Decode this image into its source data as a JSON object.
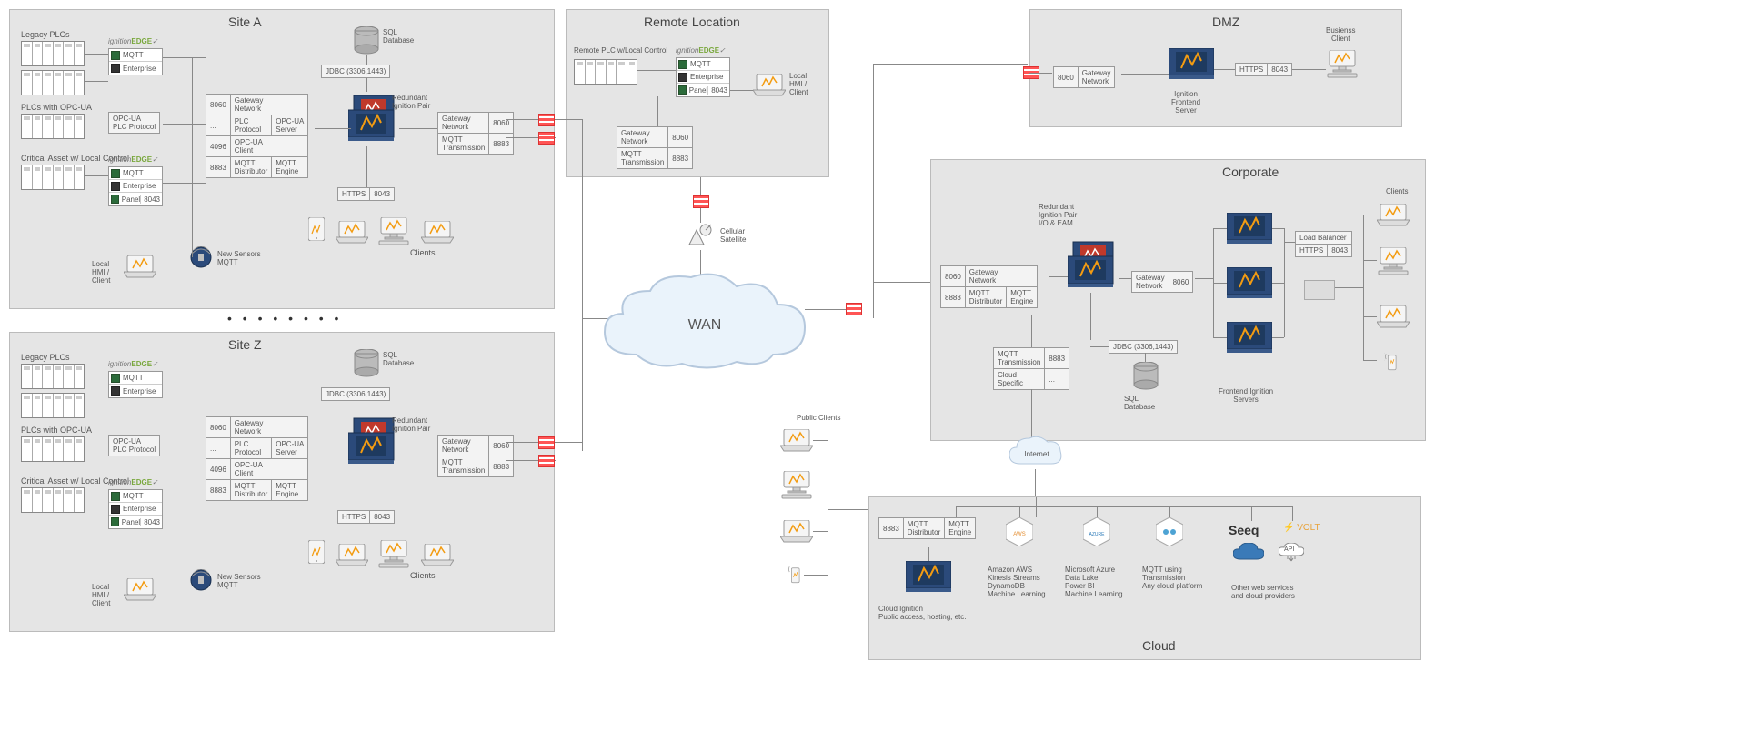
{
  "regions": {
    "siteA": {
      "title": "Site A"
    },
    "siteZ": {
      "title": "Site Z"
    },
    "remote": {
      "title": "Remote Location",
      "plc_label": "Remote PLC w/Local Control"
    },
    "dmz": {
      "title": "DMZ"
    },
    "corporate": {
      "title": "Corporate"
    },
    "cloud": {
      "title": "Cloud"
    }
  },
  "site": {
    "legacy_label": "Legacy PLCs",
    "opcua_label": "PLCs with OPC-UA",
    "critical_label": "Critical Asset w/ Local Control",
    "opcua_plc_box": "OPC-UA\nPLC Protocol",
    "local_hmi": "Local\nHMI /\nClient",
    "new_sensors": "New Sensors\nMQTT",
    "sql_db": "SQL\nDatabase",
    "jdbc": "JDBC (3306,1443)",
    "redundant_pair": "Redundant\nIgnition Pair",
    "clients": "Clients",
    "edge_rows": {
      "mqtt": "MQTT",
      "enterprise": "Enterprise",
      "panel": "Panel"
    },
    "port_https": "8043",
    "left_table": [
      [
        "8060",
        "Gateway\nNetwork",
        ""
      ],
      [
        "...",
        "PLC\nProtocol",
        "OPC-UA\nServer"
      ],
      [
        "4096",
        "OPC-UA\nClient",
        ""
      ],
      [
        "8883",
        "MQTT\nDistributor",
        "MQTT\nEngine"
      ]
    ],
    "https_row": [
      "HTTPS",
      "8043"
    ],
    "right_table": [
      [
        "Gateway\nNetwork",
        "8060"
      ],
      [
        "MQTT\nTransmission",
        "8883"
      ]
    ],
    "edge_logo_pre": "ignition",
    "edge_logo_suf": "EDGE"
  },
  "remote": {
    "local_hmi": "Local\nHMI /\nClient",
    "table": [
      [
        "Gateway\nNetwork",
        "8060"
      ],
      [
        "MQTT\nTransmission",
        "8883"
      ]
    ],
    "cellular": "Cellular\nSatellite"
  },
  "wan": {
    "label": "WAN"
  },
  "dmz": {
    "gw_row": [
      "8060",
      "Gateway\nNetwork"
    ],
    "https_row": [
      "HTTPS",
      "8043"
    ],
    "frontend": "Ignition\nFrontend\nServer",
    "business": "Busienss\nClient"
  },
  "corporate": {
    "gw_left": [
      [
        "8060",
        "Gateway\nNetwork",
        ""
      ],
      [
        "8883",
        "MQTT\nDistributor",
        "MQTT\nEngine"
      ]
    ],
    "redundant": "Redundant\nIgnition Pair\nI/O & EAM",
    "gw_right": [
      "Gateway\nNetwork",
      "8060"
    ],
    "jdbc": "JDBC (3306,1443)",
    "sql_db": "SQL\nDatabase",
    "mqtt_trans": [
      [
        "MQTT\nTransmission",
        "8883"
      ],
      [
        "Cloud\nSpecific",
        "..."
      ]
    ],
    "load_balancer": "Load Balancer",
    "lb_row": [
      "HTTPS",
      "8043"
    ],
    "frontend_servers": "Frontend Ignition\nServers",
    "clients": "Clients",
    "internet": "Internet"
  },
  "cloud": {
    "mqtt_row": [
      "8883",
      "MQTT\nDistributor",
      "MQTT\nEngine"
    ],
    "ignition": "Cloud Ignition\nPublic access, hosting, etc.",
    "aws_title": "AWS",
    "aws_desc": "Amazon AWS\nKinesis Streams\nDynamoDB\nMachine Learning",
    "azure_title": "AZURE",
    "azure_desc": "Microsoft Azure\nData Lake\nPower BI\nMachine Learning",
    "mqtt_desc": "MQTT using\nTransmission\nAny cloud platform",
    "seeq": "Seeq",
    "volt": "VOLT",
    "other": "Other web services\nand cloud providers",
    "api": "API"
  },
  "public_clients": "Public Clients"
}
